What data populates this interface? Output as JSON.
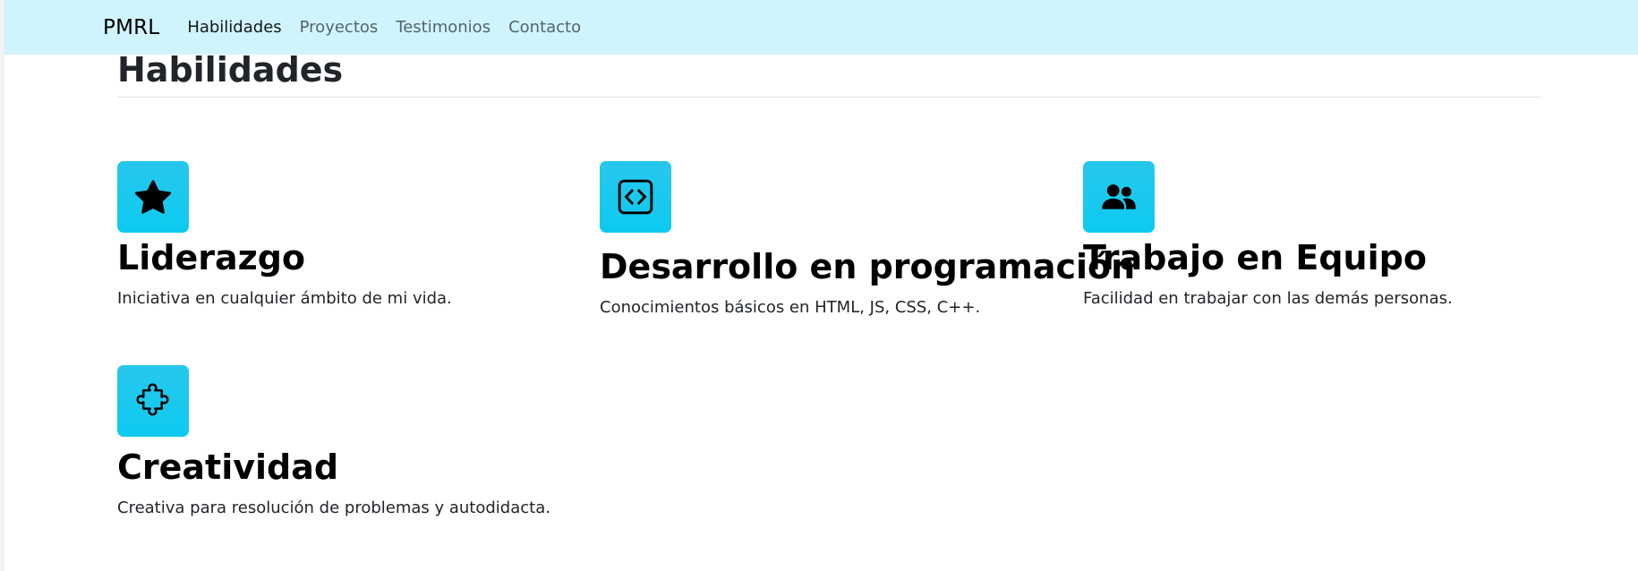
{
  "navbar": {
    "brand": "PMRL",
    "links": [
      {
        "label": "Habilidades",
        "active": true
      },
      {
        "label": "Proyectos",
        "active": false
      },
      {
        "label": "Testimonios",
        "active": false
      },
      {
        "label": "Contacto",
        "active": false
      }
    ],
    "background": "#cff4fc"
  },
  "section": {
    "title": "Habilidades",
    "features": [
      {
        "icon": "star-icon",
        "title": "Liderazgo",
        "text": "Iniciativa en cualquier ámbito de mi vida."
      },
      {
        "icon": "code-icon",
        "title": "Desarrollo en programación",
        "text": "Conocimientos básicos en HTML, JS, CSS, C++."
      },
      {
        "icon": "people-icon",
        "title": "Trabajo en Equipo",
        "text": "Facilidad en trabajar con las demás personas."
      },
      {
        "icon": "puzzle-icon",
        "title": "Creatividad",
        "text": "Creativa para resolución de problemas y autodidacta."
      }
    ]
  },
  "colors": {
    "accent": "#0dcaf0",
    "text": "#212529"
  }
}
